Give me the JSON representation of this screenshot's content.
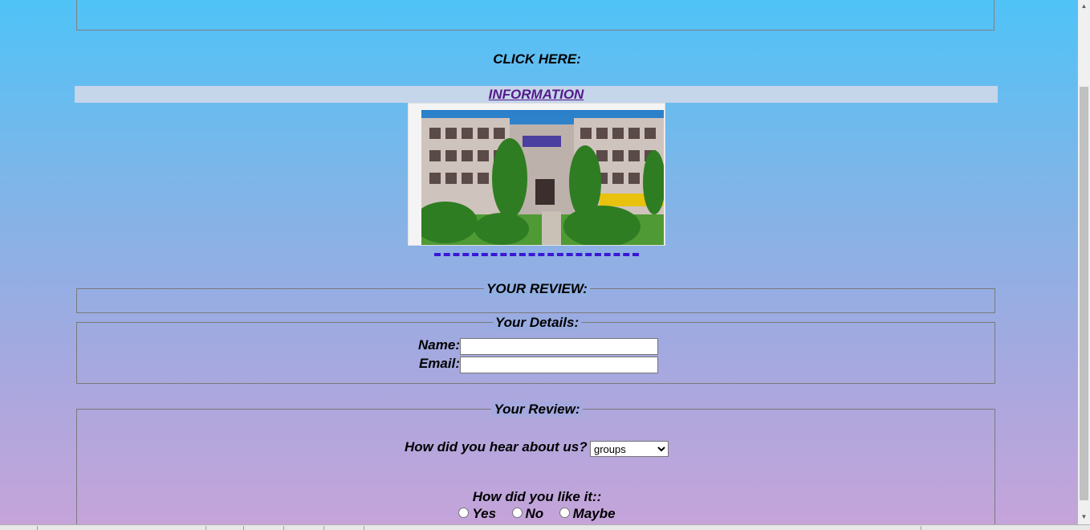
{
  "click_here_label": "CLICK HERE:",
  "information_link": "INFORMATION",
  "your_review_legend": "YOUR REVIEW:",
  "details": {
    "legend": "Your Details:",
    "name_label": "Name:",
    "name_value": "",
    "email_label": "Email:",
    "email_value": ""
  },
  "review": {
    "legend": "Your Review:",
    "hear_question": "How did you hear about us?",
    "hear_selected": "groups",
    "like_question": "How did you like it::",
    "options": [
      "Yes",
      "No",
      "Maybe"
    ]
  }
}
